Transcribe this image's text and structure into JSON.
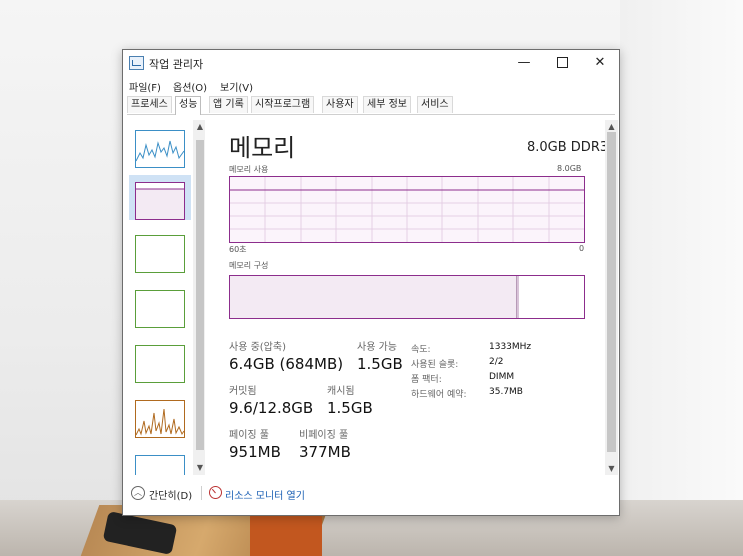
{
  "window": {
    "title": "작업 관리자"
  },
  "controls": {
    "minimize": "—",
    "close": "✕"
  },
  "menu": [
    "파일(F)",
    "옵션(O)",
    "보기(V)"
  ],
  "tabs": [
    "프로세스",
    "성능",
    "앱 기록",
    "시작프로그램",
    "사용자",
    "세부 정보",
    "서비스"
  ],
  "active_tab": "성능",
  "memory": {
    "heading": "메모리",
    "spec": "8.0GB DDR3",
    "usage_label": "메모리 사용",
    "usage_max": "8.0GB",
    "time_left": "60초",
    "time_right": "0",
    "composition_label": "메모리 구성",
    "stats": {
      "in_use_label": "사용 중(압축)",
      "in_use_value": "6.4GB (684MB)",
      "available_label": "사용 가능",
      "available_value": "1.5GB",
      "committed_label": "커밋됨",
      "committed_value": "9.6/12.8GB",
      "cached_label": "캐시됨",
      "cached_value": "1.5GB",
      "paged_label": "페이징 풀",
      "paged_value": "951MB",
      "nonpaged_label": "비페이징 풀",
      "nonpaged_value": "377MB"
    },
    "details": {
      "speed_label": "속도:",
      "speed_value": "1333MHz",
      "slots_label": "사용된 슬롯:",
      "slots_value": "2/2",
      "form_label": "폼 팩터:",
      "form_value": "DIMM",
      "reserved_label": "하드웨어 예약:",
      "reserved_value": "35.7MB"
    }
  },
  "footer": {
    "fewer_details": "간단히(D)",
    "resource_monitor": "리소스 모니터 열기"
  },
  "colors": {
    "memory": "#8c2d8c",
    "cpu": "#3b8fc6",
    "disk": "#5a9e3a",
    "ethernet": "#b06a1f"
  }
}
